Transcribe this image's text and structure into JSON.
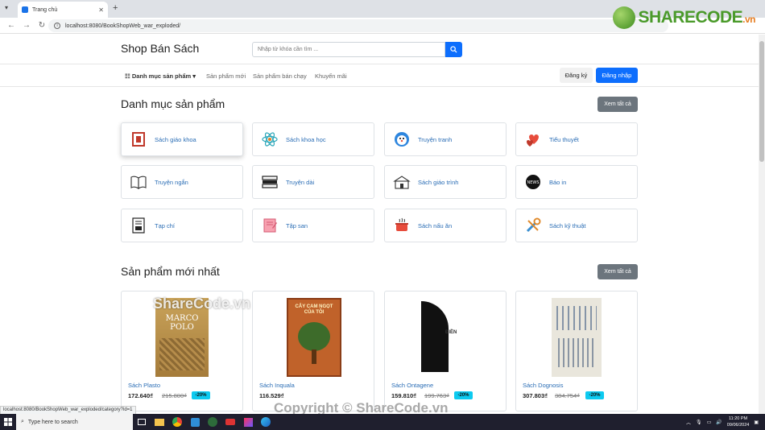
{
  "browser": {
    "tab_title": "Trang chủ",
    "url": "localhost:8080/BookShopWeb_war_exploded/",
    "status_url": "localhost:8080/BookShopWeb_war_exploded/category?id=1"
  },
  "logo": {
    "share": "SHARECODE",
    "vn": ".vn"
  },
  "header": {
    "brand": "Shop Bán Sách",
    "search_placeholder": "Nhập từ khóa cần tìm ..."
  },
  "nav": {
    "categories": "Danh mục sản phẩm",
    "new_products": "Sản phẩm mới",
    "best_sellers": "Sản phẩm bán chạy",
    "promotions": "Khuyến mãi",
    "register": "Đăng ký",
    "login": "Đăng nhập"
  },
  "categories_section": {
    "title": "Danh mục sản phẩm",
    "view_all": "Xem tất cả",
    "items": [
      {
        "label": "Sách giáo khoa",
        "icon": "textbook-icon"
      },
      {
        "label": "Sách khoa học",
        "icon": "atom-icon"
      },
      {
        "label": "Truyện tranh",
        "icon": "comic-icon"
      },
      {
        "label": "Tiểu thuyết",
        "icon": "hearts-icon"
      },
      {
        "label": "Truyện ngắn",
        "icon": "open-book-icon"
      },
      {
        "label": "Truyện dài",
        "icon": "book-stack-icon"
      },
      {
        "label": "Sách giáo trình",
        "icon": "school-icon"
      },
      {
        "label": "Báo in",
        "icon": "news-icon"
      },
      {
        "label": "Tạp chí",
        "icon": "magazine-icon"
      },
      {
        "label": "Tập san",
        "icon": "notebook-icon"
      },
      {
        "label": "Sách nấu ăn",
        "icon": "cooking-pot-icon"
      },
      {
        "label": "Sách kỹ thuật",
        "icon": "tools-icon"
      }
    ]
  },
  "products_section": {
    "title": "Sản phẩm mới nhất",
    "view_all": "Xem tất cả",
    "items": [
      {
        "name": "Sách Plasto",
        "price": "172.640₫",
        "old_price": "215.800₫",
        "discount": "-20%",
        "cover_text": "MARCO POLO"
      },
      {
        "name": "Sách Inquala",
        "price": "116.529₫",
        "old_price": "",
        "discount": "",
        "cover_text": "CÂY CAM NGỌT CỦA TÔI"
      },
      {
        "name": "Sách Ontagene",
        "price": "159.810₫",
        "old_price": "199.763₫",
        "discount": "-20%",
        "cover_text": "ĐIỀN"
      },
      {
        "name": "Sách Dognosis",
        "price": "307.803₫",
        "old_price": "384.754₫",
        "discount": "-20%",
        "cover_text": ""
      }
    ]
  },
  "watermarks": {
    "sharecode": "ShareCode.vn",
    "copyright": "Copyright © ShareCode.vn"
  },
  "taskbar": {
    "search_placeholder": "Type here to search",
    "time": "11:20 PM",
    "date": "09/06/2024"
  }
}
